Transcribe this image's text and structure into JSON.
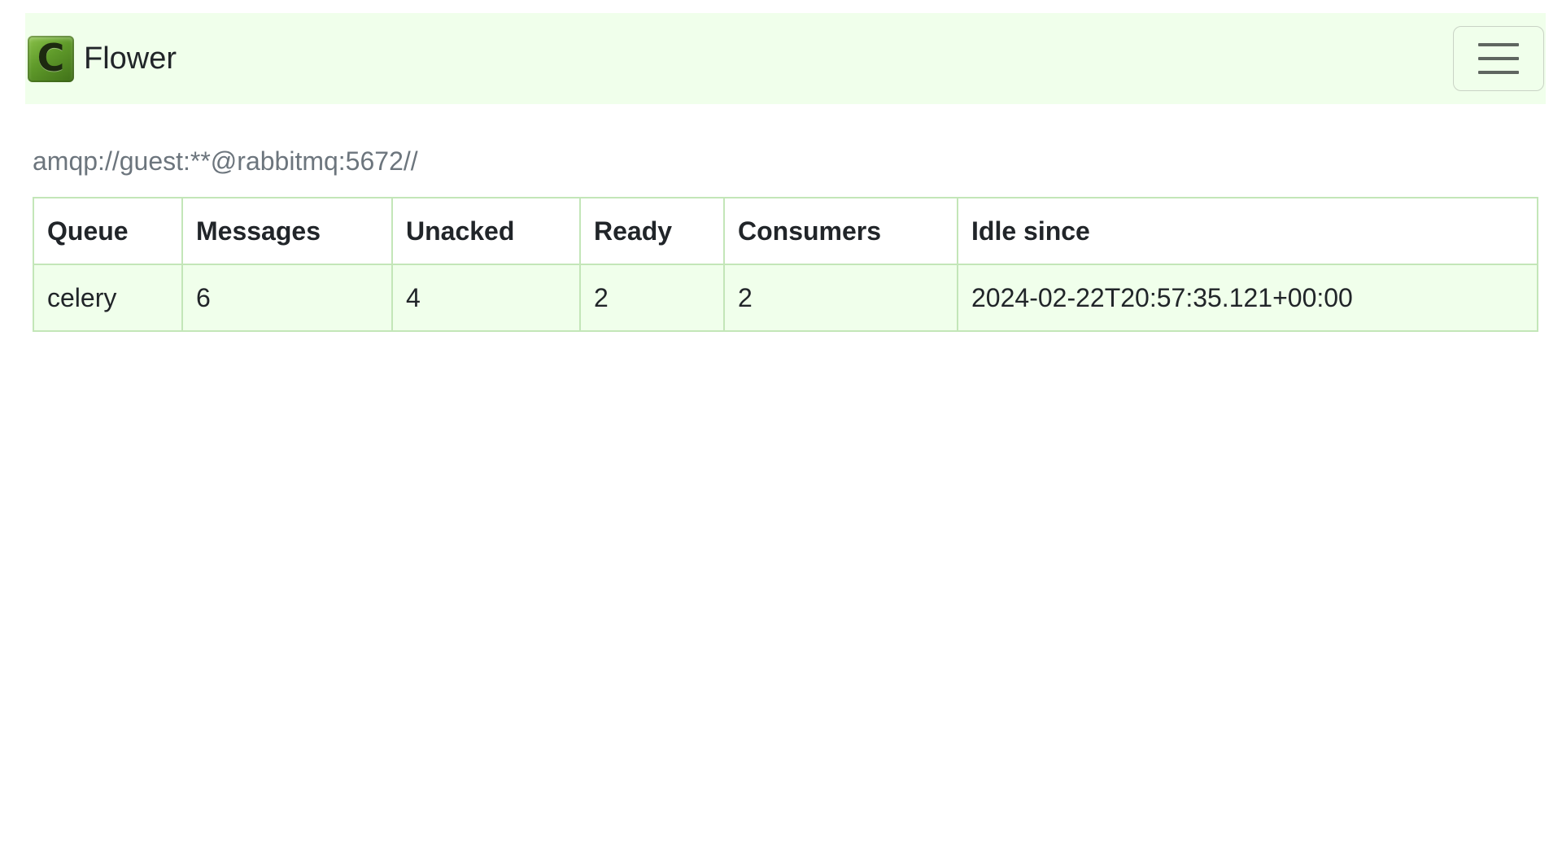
{
  "navbar": {
    "brand_letter": "C",
    "brand_name": "Flower",
    "logo_icon": "celery-logo-icon",
    "toggler_icon": "hamburger-menu-icon",
    "background": "#f0ffeb"
  },
  "broker": {
    "url": "amqp://guest:**@rabbitmq:5672//"
  },
  "table": {
    "headers": [
      "Queue",
      "Messages",
      "Unacked",
      "Ready",
      "Consumers",
      "Idle since"
    ],
    "rows": [
      [
        "celery",
        "6",
        "4",
        "2",
        "2",
        "2024-02-22T20:57:35.121+00:00"
      ]
    ],
    "border_color": "#c3e6b8",
    "row_background": "#f0ffeb"
  }
}
